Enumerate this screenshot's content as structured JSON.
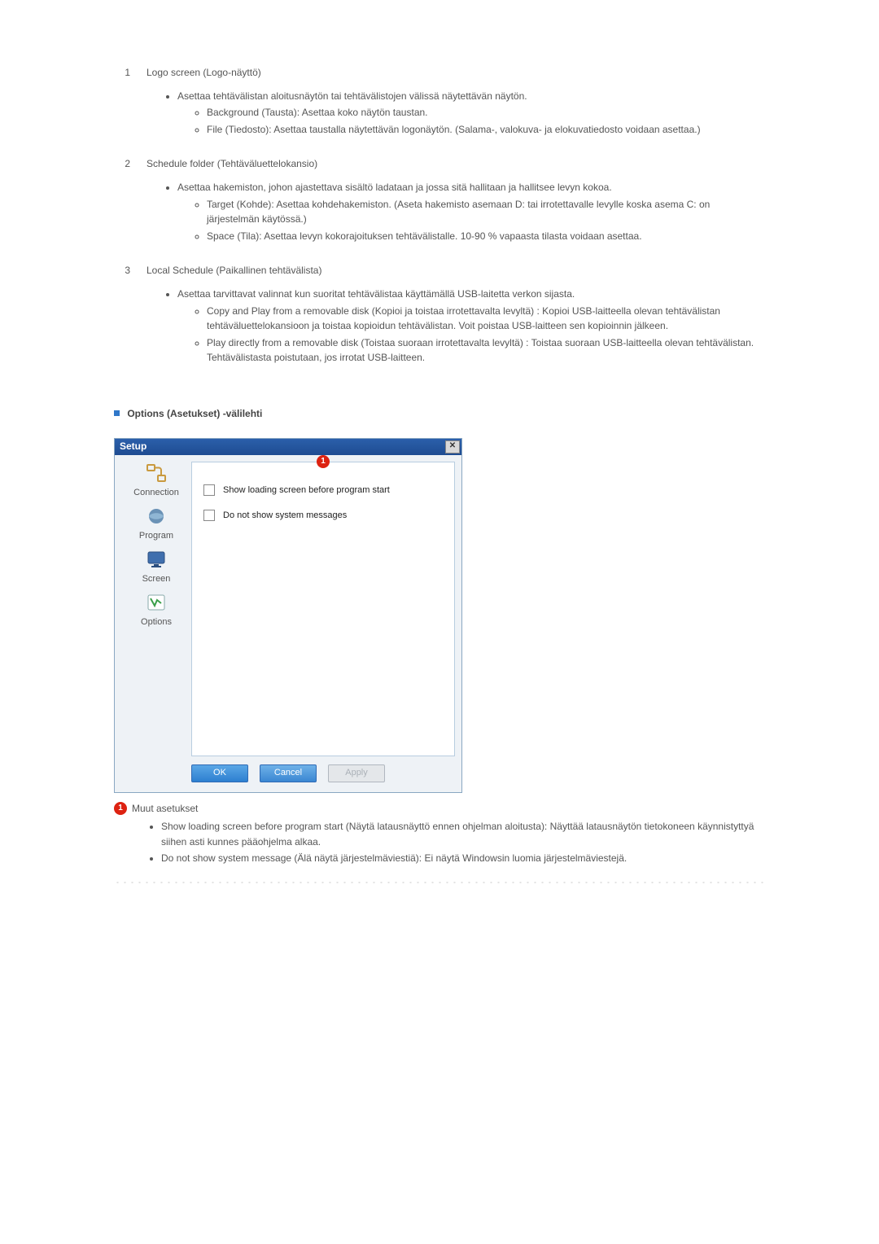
{
  "sections": [
    {
      "num": "1",
      "title": "Logo screen (Logo-näyttö)",
      "bullets": [
        {
          "text": "Asettaa tehtävälistan aloitusnäytön tai tehtävälistojen välissä näytettävän näytön.",
          "sub": [
            "Background (Tausta): Asettaa koko näytön taustan.",
            "File (Tiedosto): Asettaa taustalla näytettävän logonäytön. (Salama-, valokuva- ja elokuvatiedosto voidaan asettaa.)"
          ]
        }
      ]
    },
    {
      "num": "2",
      "title": "Schedule folder (Tehtäväluettelokansio)",
      "bullets": [
        {
          "text": "Asettaa hakemiston, johon ajastettava sisältö ladataan ja jossa sitä hallitaan ja hallitsee levyn kokoa.",
          "sub": [
            "Target (Kohde): Asettaa kohdehakemiston.\n(Aseta hakemisto asemaan D: tai irrotettavalle levylle koska asema C: on järjestelmän käytössä.)",
            "Space (Tila): Asettaa levyn kokorajoituksen tehtävälistalle. 10-90 % vapaasta tilasta voidaan asettaa."
          ]
        }
      ]
    },
    {
      "num": "3",
      "title": "Local Schedule (Paikallinen tehtävälista)",
      "bullets": [
        {
          "text": "Asettaa tarvittavat valinnat kun suoritat tehtävälistaa käyttämällä USB-laitetta verkon sijasta.",
          "sub": [
            "Copy and Play from a removable disk (Kopioi ja toistaa irrotettavalta levyltä) : Kopioi USB-laitteella olevan tehtävälistan tehtäväluettelokansioon ja toistaa kopioidun tehtävälistan. Voit poistaa USB-laitteen sen kopioinnin jälkeen.",
            "Play directly from a removable disk (Toistaa suoraan irrotettavalta levyltä) : Toistaa suoraan USB-laitteella olevan tehtävälistan. Tehtävälistasta poistutaan, jos irrotat USB-laitteen."
          ]
        }
      ]
    }
  ],
  "tab_heading": "Options (Asetukset) -välilehti",
  "dialog": {
    "title": "Setup",
    "close": "✕",
    "marker": "1",
    "side": {
      "connection": "Connection",
      "program": "Program",
      "screen": "Screen",
      "options": "Options"
    },
    "opts": {
      "show_loading": "Show loading screen before program start",
      "no_sys_msg": "Do not show system messages"
    },
    "buttons": {
      "ok": "OK",
      "cancel": "Cancel",
      "apply": "Apply"
    }
  },
  "footer": {
    "marker": "1",
    "title": "Muut asetukset",
    "bullets": [
      "Show loading screen before program start (Näytä latausnäyttö ennen ohjelman aloitusta): Näyttää latausnäytön tietokoneen käynnistyttyä siihen asti kunnes pääohjelma alkaa.",
      "Do not show system message (Älä näytä järjestelmäviestiä): Ei näytä Windowsin luomia järjestelmäviestejä."
    ]
  }
}
